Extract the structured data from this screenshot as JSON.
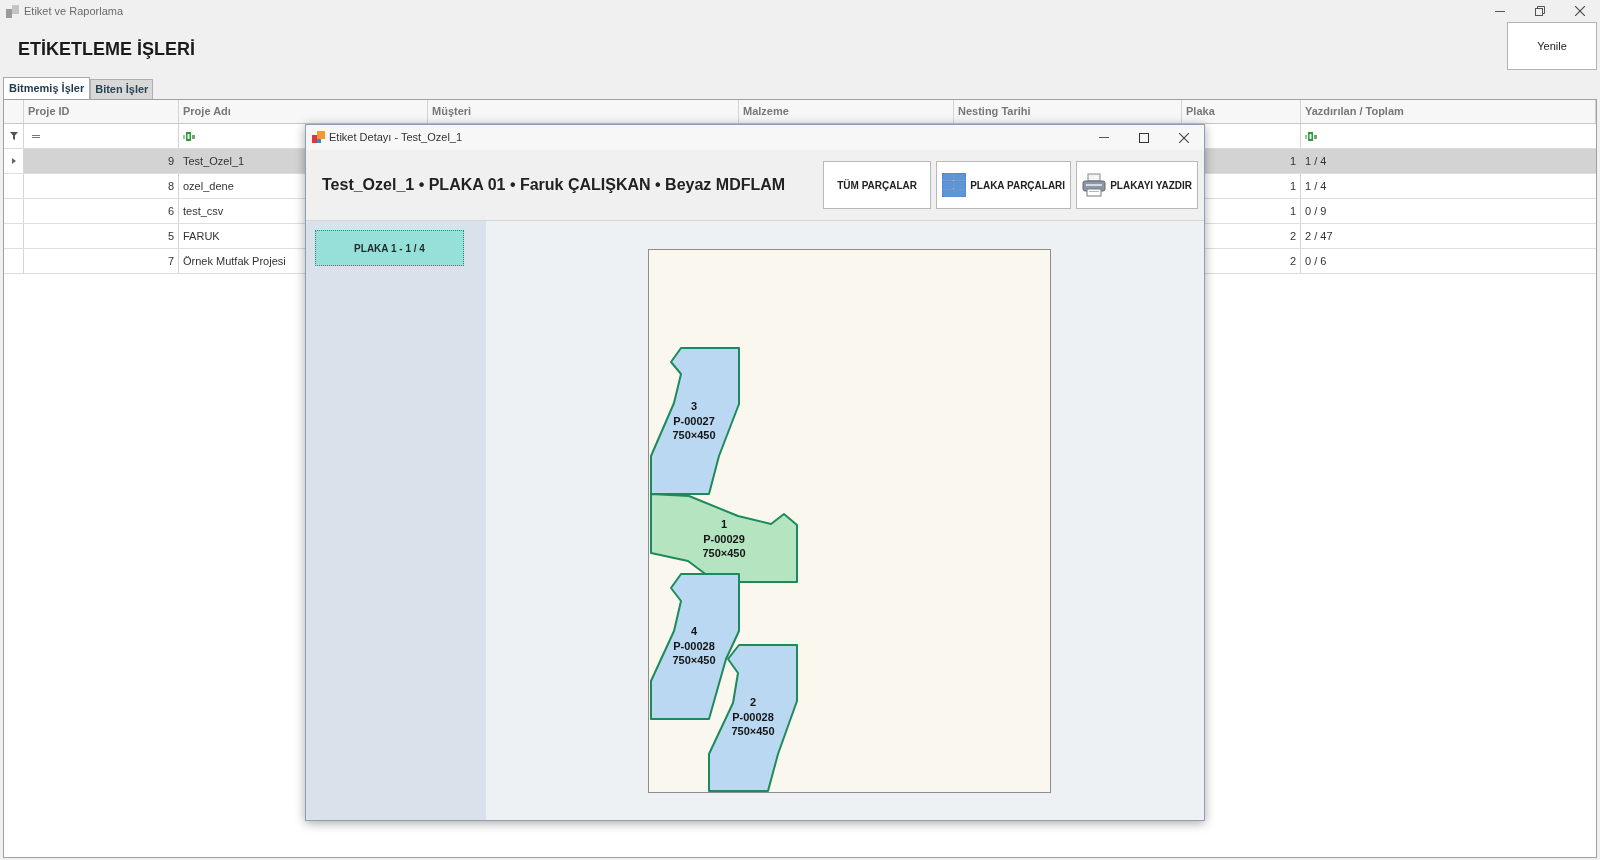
{
  "window": {
    "title": "Etiket ve Raporlama"
  },
  "heading": "ETİKETLEME İŞLERİ",
  "refresh_button": {
    "label": "Yenile"
  },
  "tabs": [
    {
      "label": "Bitmemiş İşler",
      "selected": true
    },
    {
      "label": "Biten İşler",
      "selected": false
    }
  ],
  "table": {
    "columns": [
      "Proje ID",
      "Proje Adı",
      "Müşteri",
      "Malzeme",
      "Nesting Tarihi",
      "Plaka",
      "Yazdırılan / Toplam"
    ],
    "rows": [
      {
        "proje_id": "9",
        "proje_adi": "Test_Ozel_1",
        "plaka": "1",
        "yazdirilan_toplam": "1 / 4",
        "selected": true
      },
      {
        "proje_id": "8",
        "proje_adi": "ozel_dene",
        "plaka": "1",
        "yazdirilan_toplam": "1 / 4",
        "selected": false
      },
      {
        "proje_id": "6",
        "proje_adi": "test_csv",
        "plaka": "1",
        "yazdirilan_toplam": "0 / 9",
        "selected": false
      },
      {
        "proje_id": "5",
        "proje_adi": "FARUK",
        "plaka": "2",
        "yazdirilan_toplam": "2 / 47",
        "selected": false
      },
      {
        "proje_id": "7",
        "proje_adi": "Örnek Mutfak Projesi",
        "plaka": "2",
        "yazdirilan_toplam": "0 / 6",
        "selected": false
      }
    ]
  },
  "dialog": {
    "title": "Etiket Detayı - Test_Ozel_1",
    "header": "Test_Ozel_1 • PLAKA 01 • Faruk ÇALIŞKAN • Beyaz MDFLAM",
    "buttons": [
      {
        "label": "TÜM PARÇALAR",
        "kind": "text"
      },
      {
        "label": "PLAKA PARÇALARI",
        "kind": "grid"
      },
      {
        "label": "PLAKAYI YAZDIR",
        "kind": "printer"
      }
    ],
    "plates": [
      {
        "label": "PLAKA 1 - 1 / 4",
        "selected": true
      }
    ],
    "plate": {
      "parts": [
        {
          "number": "3",
          "code": "P-00027",
          "size": "750×450",
          "color": "#bad8f2"
        },
        {
          "number": "1",
          "code": "P-00029",
          "size": "750×450",
          "color": "#b4e4c0"
        },
        {
          "number": "4",
          "code": "P-00028",
          "size": "750×450",
          "color": "#bad8f2"
        },
        {
          "number": "2",
          "code": "P-00028",
          "size": "750×450",
          "color": "#bad8f2"
        }
      ]
    }
  }
}
